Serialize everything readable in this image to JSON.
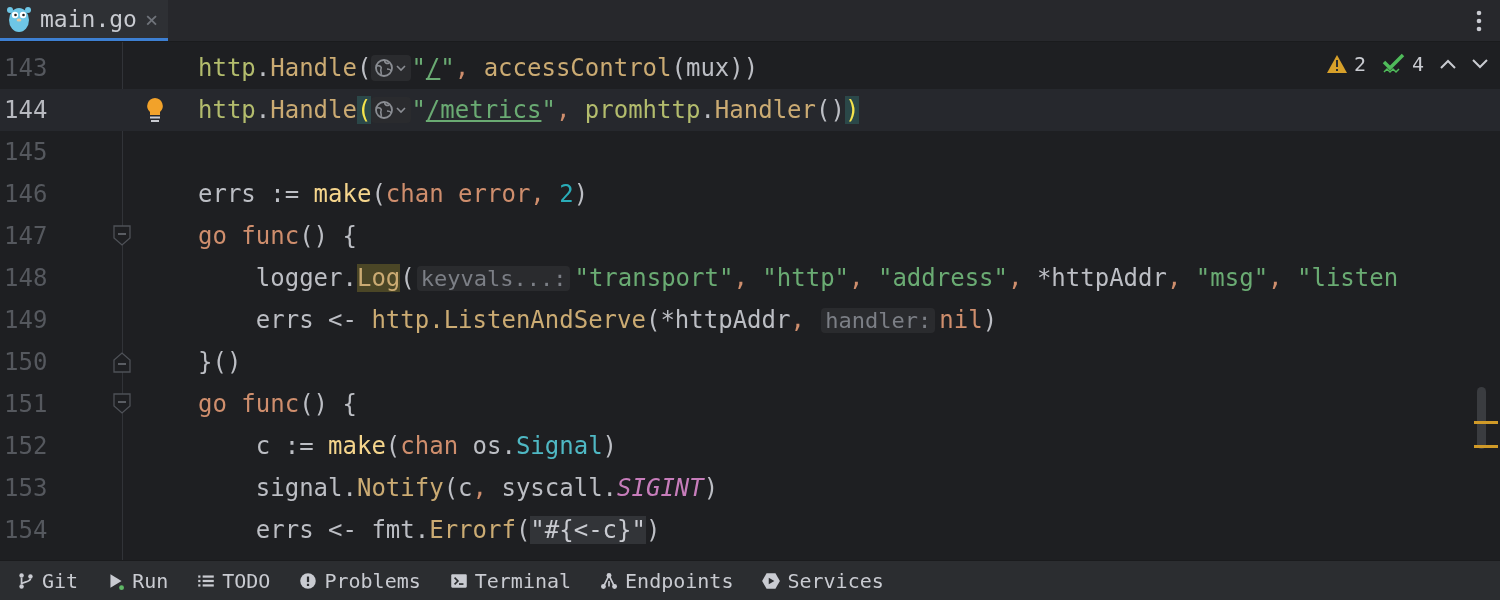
{
  "tabs": [
    {
      "label": "main.go",
      "close": "×",
      "selected": true
    }
  ],
  "inspections": {
    "warnings": "2",
    "weak_warnings": "4"
  },
  "lines": [
    {
      "number": "143",
      "current": false,
      "bulb": false,
      "tokens": [
        {
          "kind": "pkg",
          "text": "http"
        },
        {
          "kind": "p",
          "text": "."
        },
        {
          "kind": "fn",
          "text": "Handle"
        },
        {
          "kind": "p",
          "text": "("
        },
        {
          "kind": "globe"
        },
        {
          "kind": "str",
          "text": "\""
        },
        {
          "kind": "url",
          "text": "/"
        },
        {
          "kind": "str",
          "text": "\""
        },
        {
          "kind": "comma",
          "text": ", "
        },
        {
          "kind": "fn",
          "text": "accessControl"
        },
        {
          "kind": "p",
          "text": "(mux))"
        }
      ]
    },
    {
      "number": "144",
      "current": true,
      "bulb": true,
      "tokens": [
        {
          "kind": "pkg",
          "text": "http"
        },
        {
          "kind": "p",
          "text": "."
        },
        {
          "kind": "fn",
          "text": "Handle"
        },
        {
          "kind": "brace",
          "text": "("
        },
        {
          "kind": "globe"
        },
        {
          "kind": "str",
          "text": "\""
        },
        {
          "kind": "url",
          "text": "/metrics"
        },
        {
          "kind": "str",
          "text": "\""
        },
        {
          "kind": "comma",
          "text": ", "
        },
        {
          "kind": "pkg",
          "text": "promhttp"
        },
        {
          "kind": "p",
          "text": "."
        },
        {
          "kind": "fn",
          "text": "Handler"
        },
        {
          "kind": "p",
          "text": "()"
        },
        {
          "kind": "brace",
          "text": ")"
        }
      ]
    },
    {
      "number": "145",
      "current": false,
      "bulb": false
    },
    {
      "number": "146",
      "current": false,
      "bulb": false,
      "tokens": [
        {
          "kind": "p",
          "text": "errs := "
        },
        {
          "kind": "builtin",
          "text": "make"
        },
        {
          "kind": "p",
          "text": "("
        },
        {
          "kind": "kw",
          "text": "chan error"
        },
        {
          "kind": "comma",
          "text": ", "
        },
        {
          "kind": "num",
          "text": "2"
        },
        {
          "kind": "p",
          "text": ")"
        }
      ]
    },
    {
      "number": "147",
      "current": false,
      "bulb": false,
      "fold_start": true,
      "tokens": [
        {
          "kind": "kw",
          "text": "go func"
        },
        {
          "kind": "p",
          "text": "() {"
        }
      ]
    },
    {
      "number": "148",
      "current": false,
      "bulb": false,
      "tokens": [
        {
          "kind": "p",
          "text": "    logger."
        },
        {
          "kind": "fnhl",
          "text": "Log"
        },
        {
          "kind": "p",
          "text": "("
        },
        {
          "kind": "hint",
          "text": "keyvals...:"
        },
        {
          "kind": "str",
          "text": "\"transport\""
        },
        {
          "kind": "comma",
          "text": ", "
        },
        {
          "kind": "str",
          "text": "\"http\""
        },
        {
          "kind": "comma",
          "text": ", "
        },
        {
          "kind": "str",
          "text": "\"address\""
        },
        {
          "kind": "comma",
          "text": ", "
        },
        {
          "kind": "p",
          "text": "*httpAddr"
        },
        {
          "kind": "comma",
          "text": ", "
        },
        {
          "kind": "str",
          "text": "\"msg\""
        },
        {
          "kind": "comma",
          "text": ", "
        },
        {
          "kind": "str",
          "text": "\"listen"
        }
      ]
    },
    {
      "number": "149",
      "current": false,
      "bulb": false,
      "tokens": [
        {
          "kind": "p",
          "text": "    errs <- "
        },
        {
          "kind": "fn",
          "text": "http.ListenAndServe"
        },
        {
          "kind": "p",
          "text": "(*httpAddr"
        },
        {
          "kind": "comma",
          "text": ", "
        },
        {
          "kind": "hint",
          "text": "handler:"
        },
        {
          "kind": "kw",
          "text": "nil"
        },
        {
          "kind": "p",
          "text": ")"
        }
      ]
    },
    {
      "number": "150",
      "current": false,
      "bulb": false,
      "fold_end": true,
      "tokens": [
        {
          "kind": "p",
          "text": "}()"
        }
      ]
    },
    {
      "number": "151",
      "current": false,
      "bulb": false,
      "fold_start": true,
      "tokens": [
        {
          "kind": "kw",
          "text": "go func"
        },
        {
          "kind": "p",
          "text": "() {"
        }
      ]
    },
    {
      "number": "152",
      "current": false,
      "bulb": false,
      "tokens": [
        {
          "kind": "p",
          "text": "    c := "
        },
        {
          "kind": "builtin",
          "text": "make"
        },
        {
          "kind": "p",
          "text": "("
        },
        {
          "kind": "kw",
          "text": "chan "
        },
        {
          "kind": "p",
          "text": "os."
        },
        {
          "kind": "type",
          "text": "Signal"
        },
        {
          "kind": "p",
          "text": ")"
        }
      ]
    },
    {
      "number": "153",
      "current": false,
      "bulb": false,
      "tokens": [
        {
          "kind": "p",
          "text": "    signal."
        },
        {
          "kind": "fn",
          "text": "Notify"
        },
        {
          "kind": "p",
          "text": "(c"
        },
        {
          "kind": "comma",
          "text": ", "
        },
        {
          "kind": "p",
          "text": "syscall."
        },
        {
          "kind": "const",
          "text": "SIGINT"
        },
        {
          "kind": "p",
          "text": ")"
        }
      ]
    },
    {
      "number": "154",
      "current": false,
      "bulb": false,
      "tokens": [
        {
          "kind": "p",
          "text": "    errs <- fmt."
        },
        {
          "kind": "fn",
          "text": "Errorf"
        },
        {
          "kind": "p",
          "text": "("
        },
        {
          "kind": "inj",
          "text": "\"#{<-c}\""
        },
        {
          "kind": "p",
          "text": ")"
        }
      ]
    }
  ],
  "tool_windows": [
    {
      "kind": "git",
      "label": "Git"
    },
    {
      "kind": "run",
      "label": "Run"
    },
    {
      "kind": "todo",
      "label": "TODO"
    },
    {
      "kind": "problems",
      "label": "Problems"
    },
    {
      "kind": "terminal",
      "label": "Terminal"
    },
    {
      "kind": "endpoints",
      "label": "Endpoints"
    },
    {
      "kind": "services",
      "label": "Services"
    }
  ]
}
